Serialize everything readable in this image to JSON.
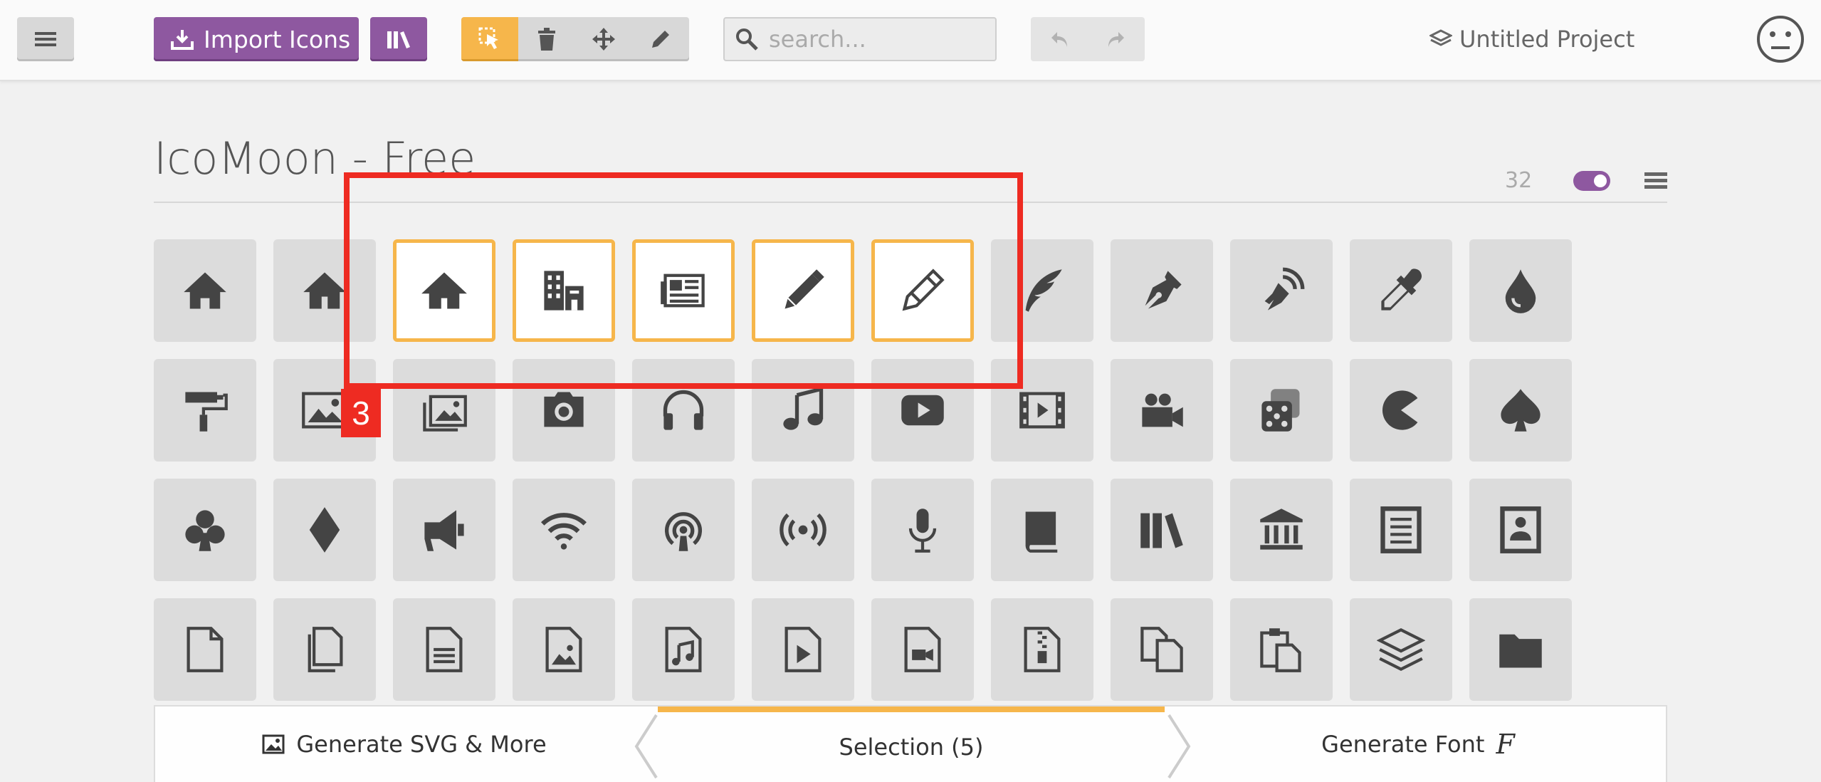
{
  "toolbar": {
    "import_label": "Import Icons",
    "search_placeholder": "search...",
    "project_name": "Untitled Project"
  },
  "set": {
    "title": "IcoMoon - Free",
    "count": "32"
  },
  "highlight": {
    "badge": "3"
  },
  "grid": {
    "rows": [
      [
        "home",
        "home2",
        "home3",
        "office",
        "newspaper",
        "pencil",
        "pencil2",
        "quill",
        "pen",
        "blog",
        "eyedropper",
        "droplet"
      ],
      [
        "paint-format",
        "image",
        "images",
        "camera",
        "headphones",
        "music",
        "play",
        "film",
        "video-camera",
        "dice",
        "pacman",
        "spades"
      ],
      [
        "clubs",
        "diamonds",
        "bullhorn",
        "connection",
        "podcast",
        "feed",
        "mic",
        "book",
        "books",
        "library",
        "file-text",
        "profile"
      ],
      [
        "file-empty",
        "files-empty",
        "file-text2",
        "file-picture",
        "file-music",
        "file-play",
        "file-video",
        "file-zip",
        "copy",
        "paste",
        "stack",
        "folder"
      ]
    ],
    "selected": [
      "home3",
      "office",
      "newspaper",
      "pencil",
      "pencil2"
    ]
  },
  "bottombar": {
    "generate_svg_label": "Generate SVG & More",
    "selection_label": "Selection (5)",
    "generate_font_label": "Generate Font",
    "font_glyph": "F"
  },
  "colors": {
    "accent_purple": "#8e58a0",
    "selection_orange": "#f6b64b",
    "highlight_red": "#ee2b22",
    "tile_bg": "#dcdcdc",
    "icon": "#444444"
  }
}
